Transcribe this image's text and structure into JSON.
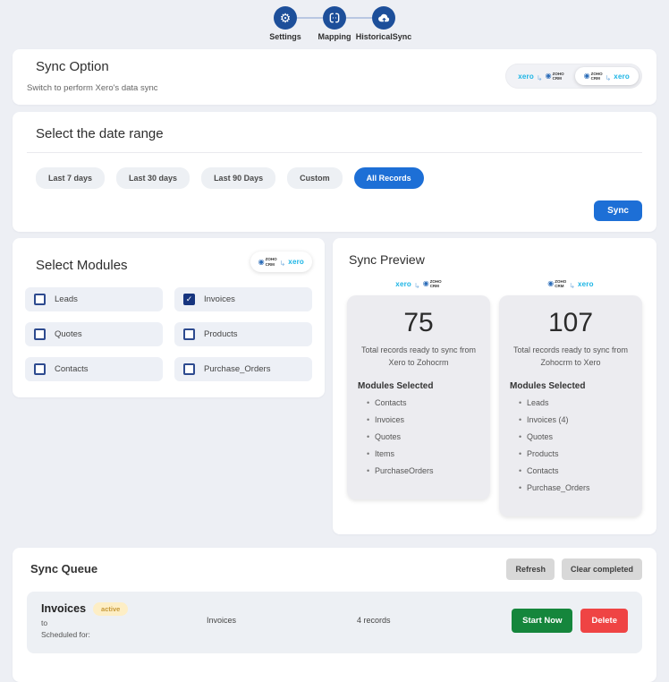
{
  "brands": {
    "xero": "xero",
    "zoho": "ZOHO CRM"
  },
  "colors": {
    "accent_blue": "#1d6fd6",
    "step_blue": "#1d4f9a",
    "success_green": "#15863c",
    "danger_red": "#ef4444",
    "badge_bg": "#fdeec5",
    "badge_text": "#c79a3b",
    "xero_cyan": "#1ab4e5",
    "zoho_blue": "#2b6cb8"
  },
  "stepper": {
    "steps": [
      {
        "label": "Settings",
        "icon": "gear"
      },
      {
        "label": "Mapping",
        "icon": "mapping"
      },
      {
        "label": "HistoricalSync",
        "icon": "cloud-sync"
      }
    ]
  },
  "sync_option": {
    "title": "Sync Option",
    "subtitle": "Switch to perform Xero's data sync",
    "toggle_options": [
      {
        "from": "xero",
        "to": "zoho",
        "selected": false
      },
      {
        "from": "zoho",
        "to": "xero",
        "selected": true
      }
    ]
  },
  "date_range": {
    "title": "Select the date range",
    "options": [
      "Last 7 days",
      "Last 30 days",
      "Last 90 Days",
      "Custom",
      "All Records"
    ],
    "selected": "All Records",
    "sync_button": "Sync"
  },
  "modules": {
    "title": "Select Modules",
    "direction": {
      "from": "zoho",
      "to": "xero"
    },
    "items": [
      {
        "label": "Leads",
        "checked": false
      },
      {
        "label": "Invoices",
        "checked": true
      },
      {
        "label": "Quotes",
        "checked": false
      },
      {
        "label": "Products",
        "checked": false
      },
      {
        "label": "Contacts",
        "checked": false
      },
      {
        "label": "Purchase_Orders",
        "checked": false
      }
    ]
  },
  "sync_preview": {
    "title": "Sync Preview",
    "cards": [
      {
        "from": "xero",
        "to": "zoho",
        "count": "75",
        "description": "Total records ready to sync from Xero to Zohocrm",
        "modules_title": "Modules Selected",
        "modules": [
          "Contacts",
          "Invoices",
          "Quotes",
          "Items",
          "PurchaseOrders"
        ]
      },
      {
        "from": "zoho",
        "to": "xero",
        "count": "107",
        "description": "Total records ready to sync from Zohocrm to Xero",
        "modules_title": "Modules Selected",
        "modules": [
          "Leads",
          "Invoices (4)",
          "Quotes",
          "Products",
          "Contacts",
          "Purchase_Orders"
        ]
      }
    ]
  },
  "sync_queue": {
    "title": "Sync Queue",
    "refresh_label": "Refresh",
    "clear_label": "Clear completed",
    "row": {
      "name": "Invoices",
      "status": "active",
      "to_label": "to",
      "scheduled_label": "Scheduled for:",
      "module": "Invoices",
      "records": "4 records",
      "start_label": "Start Now",
      "delete_label": "Delete"
    }
  }
}
